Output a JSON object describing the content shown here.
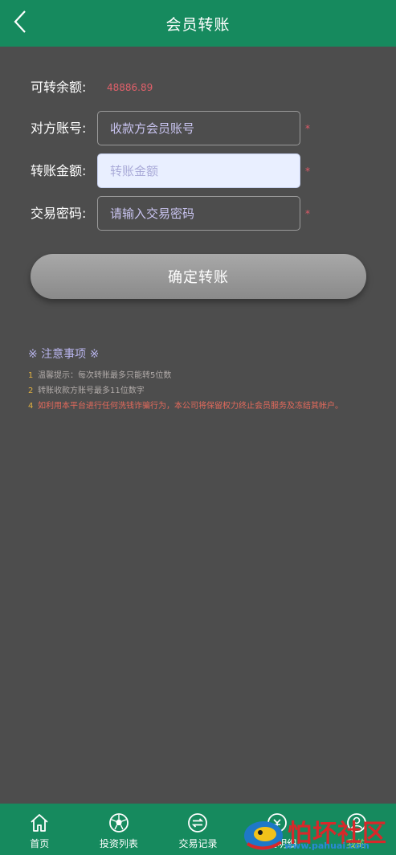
{
  "header": {
    "title": "会员转账",
    "back_icon": "chevron-left-icon"
  },
  "form": {
    "balance": {
      "label": "可转余额:",
      "value": "48886.89"
    },
    "account": {
      "label": "对方账号:",
      "placeholder": "收款方会员账号",
      "value": "",
      "required_mark": "*"
    },
    "amount": {
      "label": "转账金额:",
      "placeholder": "转账金额",
      "value": "",
      "required_mark": "*"
    },
    "password": {
      "label": "交易密码:",
      "placeholder": "请输入交易密码",
      "value": "",
      "required_mark": "*"
    },
    "submit_label": "确定转账"
  },
  "notice": {
    "title": "※ 注意事项 ※",
    "items": [
      {
        "num": "1",
        "text": "温馨提示：每次转账最多只能转5位数"
      },
      {
        "num": "2",
        "text": "转账收款方账号最多11位数字"
      },
      {
        "num": "4",
        "text": "如利用本平台进行任何洗钱诈骗行为，本公司将保留权力终止会员服务及冻结其帐户。"
      }
    ]
  },
  "tabbar": {
    "items": [
      {
        "label": "首页",
        "icon": "home-icon"
      },
      {
        "label": "投资列表",
        "icon": "soccer-ball-icon"
      },
      {
        "label": "交易记录",
        "icon": "exchange-icon"
      },
      {
        "label": "资金明细",
        "icon": "funds-icon"
      },
      {
        "label": "我的",
        "icon": "user-icon"
      }
    ]
  },
  "watermark": {
    "text": "怕坏社区",
    "url": "www.pahuai.com"
  },
  "colors": {
    "header_bg": "#168a5e",
    "page_bg": "#4d4d4d",
    "balance_value": "#e0606a",
    "warning_text": "#e46a5c",
    "notice_title": "#b8b4ec"
  }
}
